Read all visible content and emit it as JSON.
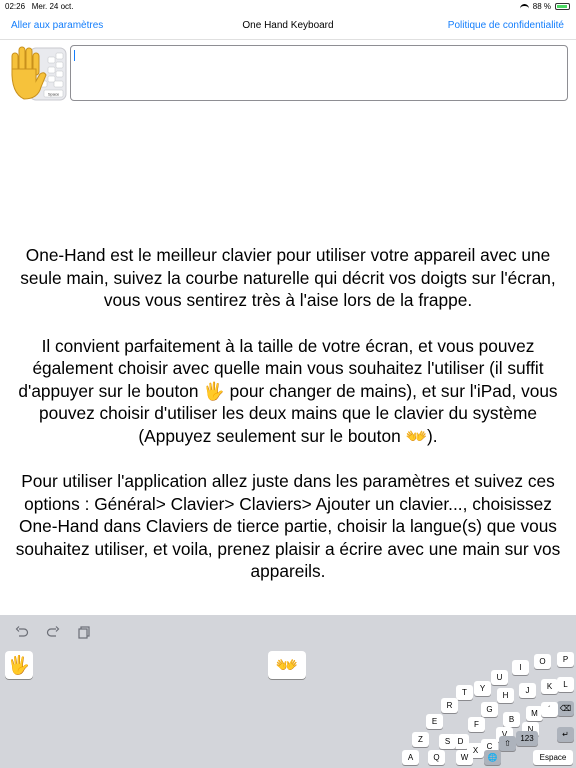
{
  "status_bar": {
    "time": "02:26",
    "date": "Mer. 24 oct.",
    "battery": "88 %"
  },
  "nav": {
    "left": "Aller aux paramètres",
    "title": "One Hand Keyboard",
    "right": "Politique de confidentialité"
  },
  "logo": {
    "key_label": "Space"
  },
  "text_field": {
    "value": ""
  },
  "description": {
    "p1": "One-Hand est le meilleur clavier pour utiliser votre appareil avec une seule main, suivez la courbe naturelle qui décrit vos doigts sur l'écran, vous vous sentirez très à l'aise lors de la frappe.",
    "p2": "Il convient parfaitement à la taille de votre écran, et vous pouvez également choisir avec quelle main vous souhaitez l'utiliser (il suffit d'appuyer sur le bouton 🖐 pour changer de mains), et sur l'iPad, vous pouvez choisir d'utiliser les deux mains que le clavier du système (Appuyez seulement sur le bouton 👐).",
    "p3": "Pour utiliser l'application allez juste dans les paramètres et suivez ces options : Général> Clavier> Claviers> Ajouter un clavier..., choisissez One-Hand dans Claviers de tierce partie, choisir la langue(s) que vous souhaitez utiliser, et voila, prenez plaisir a écrire avec une main sur vos appareils."
  },
  "keyboard": {
    "undo_icon": "undo-icon",
    "redo_icon": "redo-icon",
    "paste_icon": "clipboard-icon",
    "one_hand": "🖐",
    "two_hands": "👐",
    "keys": [
      "P",
      "O",
      "I",
      "U",
      "L",
      "K",
      "J",
      "Y",
      "H",
      "T",
      "⌫",
      "M",
      "B",
      "G",
      "R",
      "´",
      "N",
      "V",
      "F",
      "E",
      "↵",
      "C",
      "D",
      "Z",
      "123",
      "X",
      "S",
      "⇧",
      "🌐",
      "W",
      "Q",
      "A",
      "Espace"
    ]
  },
  "colors": {
    "accent": "#147efb",
    "keyboard_bg": "#d3d5da",
    "key_bg": "#ffffff"
  }
}
